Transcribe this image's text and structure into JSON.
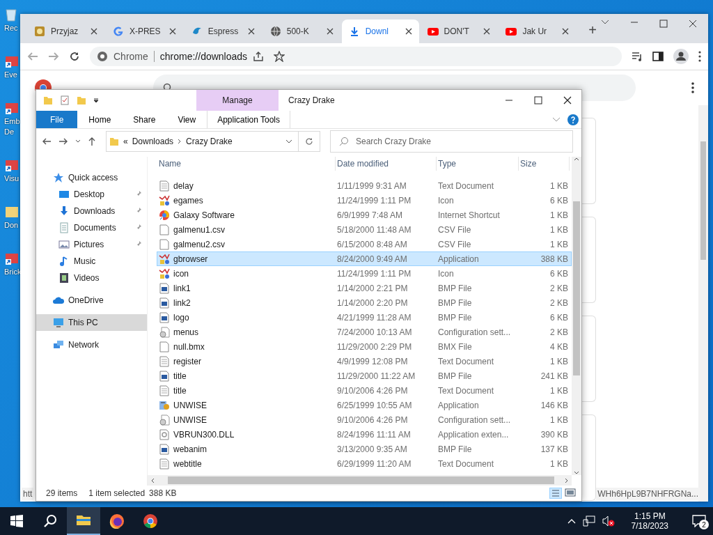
{
  "desktop": {
    "icons": [
      {
        "lines": [
          "Rec"
        ],
        "kind": "bin"
      },
      {
        "lines": [
          "Eve"
        ],
        "kind": "shortcut"
      },
      {
        "lines": [
          "Emb",
          "De"
        ],
        "kind": "shortcut"
      },
      {
        "lines": [
          "Visu"
        ],
        "kind": "shortcut"
      },
      {
        "lines": [
          "Don"
        ],
        "kind": "folder"
      },
      {
        "lines": [
          "Brick"
        ],
        "kind": "shortcut"
      }
    ]
  },
  "browser": {
    "tabs": [
      {
        "title": "Przyjaz",
        "kind": "game",
        "selected": false
      },
      {
        "title": "X-PRES",
        "kind": "google",
        "selected": false
      },
      {
        "title": "Espress",
        "kind": "bird",
        "selected": false
      },
      {
        "title": "500-K",
        "kind": "globe",
        "selected": false
      },
      {
        "title": "Downl",
        "kind": "download",
        "selected": true
      },
      {
        "title": "DON'T",
        "kind": "video",
        "selected": false
      },
      {
        "title": "Jak Ur",
        "kind": "video",
        "selected": false
      }
    ],
    "new_tab": "+",
    "omnibox": {
      "site": "Chrome",
      "url": "chrome://downloads"
    },
    "page": {
      "link_left": "htt",
      "link_right": "WHh6HpL9B7NHFRGNa..."
    }
  },
  "explorer": {
    "title": "Crazy Drake",
    "context_tab": "Manage",
    "ribbon_tabs": [
      {
        "label": "File",
        "kind": "file"
      },
      {
        "label": "Home",
        "kind": "plain"
      },
      {
        "label": "Share",
        "kind": "plain"
      },
      {
        "label": "View",
        "kind": "plain"
      },
      {
        "label": "Application Tools",
        "kind": "context"
      }
    ],
    "address": {
      "overflow": "«",
      "path": [
        "Downloads",
        "Crazy Drake"
      ]
    },
    "search": {
      "placeholder": "Search Crazy Drake"
    },
    "nav": [
      {
        "label": "Quick access",
        "kind": "star",
        "selected": false,
        "children": [
          {
            "label": "Desktop",
            "kind": "desktop",
            "pinned": true,
            "selected": false
          },
          {
            "label": "Downloads",
            "kind": "download",
            "pinned": true,
            "selected": false
          },
          {
            "label": "Documents",
            "kind": "document",
            "pinned": true,
            "selected": false
          },
          {
            "label": "Pictures",
            "kind": "pictures",
            "pinned": true,
            "selected": false
          },
          {
            "label": "Music",
            "kind": "music",
            "pinned": false,
            "selected": false
          },
          {
            "label": "Videos",
            "kind": "videos",
            "pinned": false,
            "selected": false
          }
        ]
      },
      {
        "label": "OneDrive",
        "kind": "cloud",
        "selected": false
      },
      {
        "label": "This PC",
        "kind": "pc",
        "selected": true
      },
      {
        "label": "Network",
        "kind": "network",
        "selected": false
      }
    ],
    "columns": [
      "Name",
      "Date modified",
      "Type",
      "Size"
    ],
    "rows": [
      {
        "name": "delay",
        "date": "1/11/1999 9:31 AM",
        "type": "Text Document",
        "size": "1 KB",
        "kind": "text",
        "selected": false
      },
      {
        "name": "egames",
        "date": "11/24/1999 1:11 PM",
        "type": "Icon",
        "size": "6 KB",
        "kind": "art",
        "selected": false
      },
      {
        "name": "Galaxy Software",
        "date": "6/9/1999 7:48 AM",
        "type": "Internet Shortcut",
        "size": "1 KB",
        "kind": "web",
        "selected": false
      },
      {
        "name": "galmenu1.csv",
        "date": "5/18/2000 11:48 AM",
        "type": "CSV File",
        "size": "1 KB",
        "kind": "blank",
        "selected": false
      },
      {
        "name": "galmenu2.csv",
        "date": "6/15/2000 8:48 AM",
        "type": "CSV File",
        "size": "1 KB",
        "kind": "blank",
        "selected": false
      },
      {
        "name": "gbrowser",
        "date": "8/24/2000 9:49 AM",
        "type": "Application",
        "size": "388 KB",
        "kind": "art",
        "selected": true
      },
      {
        "name": "icon",
        "date": "11/24/1999 1:11 PM",
        "type": "Icon",
        "size": "6 KB",
        "kind": "art",
        "selected": false
      },
      {
        "name": "link1",
        "date": "1/14/2000 2:21 PM",
        "type": "BMP File",
        "size": "2 KB",
        "kind": "image",
        "selected": false
      },
      {
        "name": "link2",
        "date": "1/14/2000 2:20 PM",
        "type": "BMP File",
        "size": "2 KB",
        "kind": "image",
        "selected": false
      },
      {
        "name": "logo",
        "date": "4/21/1999 11:28 AM",
        "type": "BMP File",
        "size": "6 KB",
        "kind": "image",
        "selected": false
      },
      {
        "name": "menus",
        "date": "7/24/2000 10:13 AM",
        "type": "Configuration sett...",
        "size": "2 KB",
        "kind": "settings",
        "selected": false
      },
      {
        "name": "null.bmx",
        "date": "11/29/2000 2:29 PM",
        "type": "BMX File",
        "size": "4 KB",
        "kind": "blank",
        "selected": false
      },
      {
        "name": "register",
        "date": "4/9/1999 12:08 PM",
        "type": "Text Document",
        "size": "1 KB",
        "kind": "text",
        "selected": false
      },
      {
        "name": "title",
        "date": "11/29/2000 11:22 AM",
        "type": "BMP File",
        "size": "241 KB",
        "kind": "image",
        "selected": false
      },
      {
        "name": "title",
        "date": "9/10/2006 4:26 PM",
        "type": "Text Document",
        "size": "1 KB",
        "kind": "text",
        "selected": false
      },
      {
        "name": "UNWISE",
        "date": "6/25/1999 10:55 AM",
        "type": "Application",
        "size": "146 KB",
        "kind": "installer",
        "selected": false
      },
      {
        "name": "UNWISE",
        "date": "9/10/2006 4:26 PM",
        "type": "Configuration sett...",
        "size": "1 KB",
        "kind": "settings",
        "selected": false
      },
      {
        "name": "VBRUN300.DLL",
        "date": "8/24/1996 11:11 AM",
        "type": "Application exten...",
        "size": "390 KB",
        "kind": "dll",
        "selected": false
      },
      {
        "name": "webanim",
        "date": "3/13/2000 9:35 AM",
        "type": "BMP File",
        "size": "137 KB",
        "kind": "image",
        "selected": false
      },
      {
        "name": "webtitle",
        "date": "6/29/1999 11:20 AM",
        "type": "Text Document",
        "size": "1 KB",
        "kind": "text",
        "selected": false
      }
    ],
    "status": {
      "count": "29 items",
      "selection": "1 item selected",
      "size": "388 KB"
    }
  },
  "taskbar": {
    "apps": [
      {
        "kind": "explorer",
        "active": true
      },
      {
        "kind": "firefox",
        "active": false
      },
      {
        "kind": "chrome",
        "active": false
      }
    ],
    "time": "1:15 PM",
    "date": "7/18/2023",
    "notifications": "2"
  }
}
